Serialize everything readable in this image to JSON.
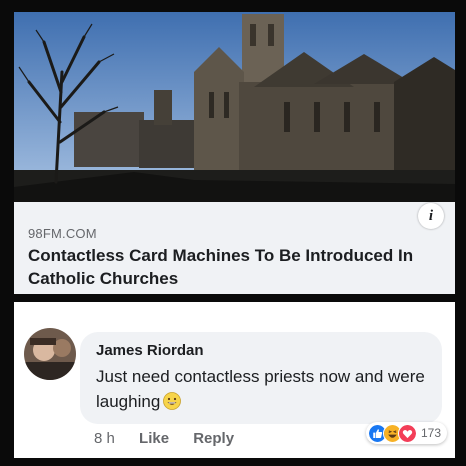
{
  "link_preview": {
    "domain": "98FM.COM",
    "title": "Contactless Card Machines To Be Introduced In Catholic Churches",
    "image": "cathedral-photo",
    "info_icon": "info-icon",
    "info_label": "i"
  },
  "comment": {
    "author": "James Riordan",
    "text": "Just need contactless priests now and were laughing",
    "emoji": "grinning-face",
    "time": "8 h",
    "like_label": "Like",
    "reply_label": "Reply",
    "reactions": [
      "like-reaction-icon",
      "haha-reaction-icon",
      "love-reaction-icon"
    ],
    "reaction_count": "173"
  },
  "colors": {
    "like_blue": "#1877f2",
    "love_red": "#f33e58",
    "haha_yellow": "#f7b125",
    "bubble_gray": "#f0f2f5"
  }
}
